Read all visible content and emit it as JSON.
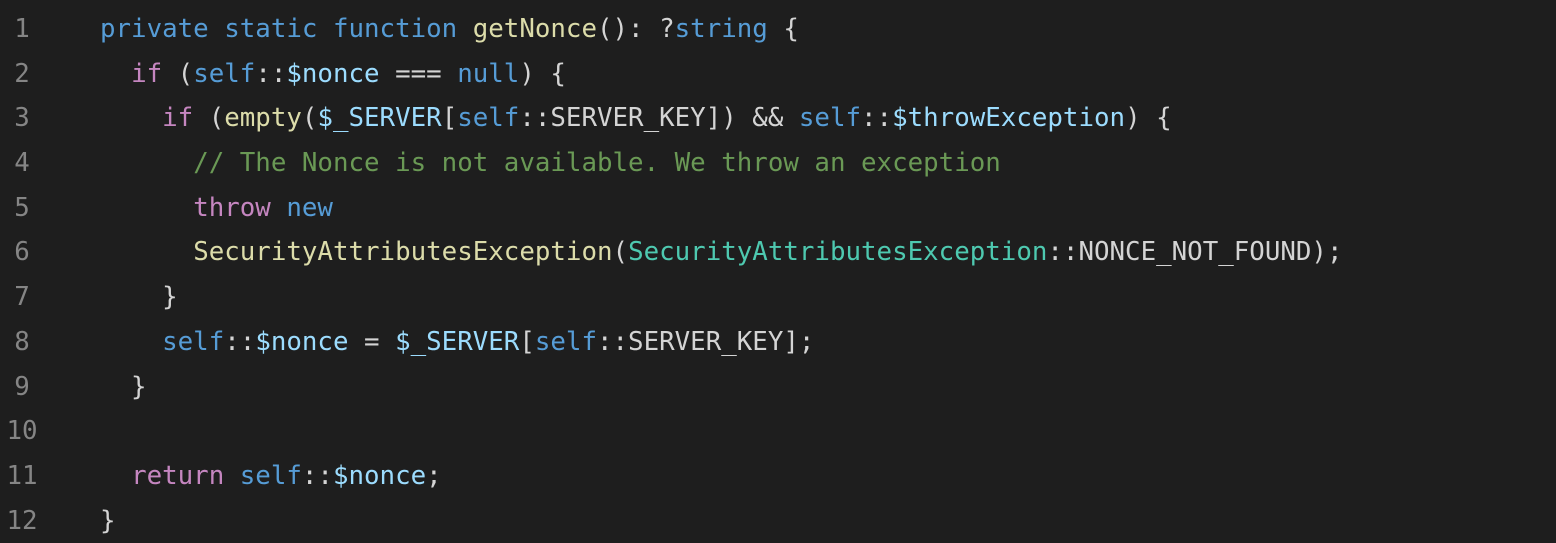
{
  "theme": {
    "background": "#1e1e1e",
    "line_number": "#858585",
    "keyword": "#569cd6",
    "control": "#c586c0",
    "function": "#dcdcaa",
    "variable": "#9cdcfe",
    "type": "#4ec9b0",
    "text": "#d4d4d4",
    "comment": "#6a9955"
  },
  "lines": [
    {
      "number": "1",
      "tokens": [
        {
          "t": "private",
          "k": "storage"
        },
        {
          "t": " ",
          "k": "text"
        },
        {
          "t": "static",
          "k": "storage"
        },
        {
          "t": " ",
          "k": "text"
        },
        {
          "t": "function",
          "k": "storage"
        },
        {
          "t": " ",
          "k": "text"
        },
        {
          "t": "getNonce",
          "k": "func"
        },
        {
          "t": "(): ?",
          "k": "text"
        },
        {
          "t": "string",
          "k": "storage"
        },
        {
          "t": " {",
          "k": "text"
        }
      ]
    },
    {
      "number": "2",
      "tokens": [
        {
          "t": "  ",
          "k": "text"
        },
        {
          "t": "if",
          "k": "keyword"
        },
        {
          "t": " (",
          "k": "text"
        },
        {
          "t": "self",
          "k": "self"
        },
        {
          "t": "::",
          "k": "text"
        },
        {
          "t": "$nonce",
          "k": "var"
        },
        {
          "t": " === ",
          "k": "text"
        },
        {
          "t": "null",
          "k": "storage"
        },
        {
          "t": ") {",
          "k": "text"
        }
      ]
    },
    {
      "number": "3",
      "tokens": [
        {
          "t": "    ",
          "k": "text"
        },
        {
          "t": "if",
          "k": "keyword"
        },
        {
          "t": " (",
          "k": "text"
        },
        {
          "t": "empty",
          "k": "func"
        },
        {
          "t": "(",
          "k": "text"
        },
        {
          "t": "$_SERVER",
          "k": "var"
        },
        {
          "t": "[",
          "k": "text"
        },
        {
          "t": "self",
          "k": "self"
        },
        {
          "t": "::SERVER_KEY]) && ",
          "k": "text"
        },
        {
          "t": "self",
          "k": "self"
        },
        {
          "t": "::",
          "k": "text"
        },
        {
          "t": "$throwException",
          "k": "var"
        },
        {
          "t": ") {",
          "k": "text"
        }
      ]
    },
    {
      "number": "4",
      "tokens": [
        {
          "t": "      ",
          "k": "text"
        },
        {
          "t": "// The Nonce is not available. We throw an exception",
          "k": "comment"
        }
      ]
    },
    {
      "number": "5",
      "tokens": [
        {
          "t": "      ",
          "k": "text"
        },
        {
          "t": "throw",
          "k": "keyword"
        },
        {
          "t": " ",
          "k": "text"
        },
        {
          "t": "new",
          "k": "storage"
        }
      ]
    },
    {
      "number": "6",
      "tokens": [
        {
          "t": "      ",
          "k": "text"
        },
        {
          "t": "SecurityAttributesException",
          "k": "func"
        },
        {
          "t": "(",
          "k": "text"
        },
        {
          "t": "SecurityAttributesException",
          "k": "type"
        },
        {
          "t": "::NONCE_NOT_FOUND);",
          "k": "text"
        }
      ]
    },
    {
      "number": "7",
      "tokens": [
        {
          "t": "    }",
          "k": "text"
        }
      ]
    },
    {
      "number": "8",
      "tokens": [
        {
          "t": "    ",
          "k": "text"
        },
        {
          "t": "self",
          "k": "self"
        },
        {
          "t": "::",
          "k": "text"
        },
        {
          "t": "$nonce",
          "k": "var"
        },
        {
          "t": " = ",
          "k": "text"
        },
        {
          "t": "$_SERVER",
          "k": "var"
        },
        {
          "t": "[",
          "k": "text"
        },
        {
          "t": "self",
          "k": "self"
        },
        {
          "t": "::SERVER_KEY];",
          "k": "text"
        }
      ]
    },
    {
      "number": "9",
      "tokens": [
        {
          "t": "  }",
          "k": "text"
        }
      ]
    },
    {
      "number": "10",
      "tokens": []
    },
    {
      "number": "11",
      "tokens": [
        {
          "t": "  ",
          "k": "text"
        },
        {
          "t": "return",
          "k": "keyword"
        },
        {
          "t": " ",
          "k": "text"
        },
        {
          "t": "self",
          "k": "self"
        },
        {
          "t": "::",
          "k": "text"
        },
        {
          "t": "$nonce",
          "k": "var"
        },
        {
          "t": ";",
          "k": "text"
        }
      ]
    },
    {
      "number": "12",
      "tokens": [
        {
          "t": "}",
          "k": "text"
        }
      ]
    }
  ]
}
